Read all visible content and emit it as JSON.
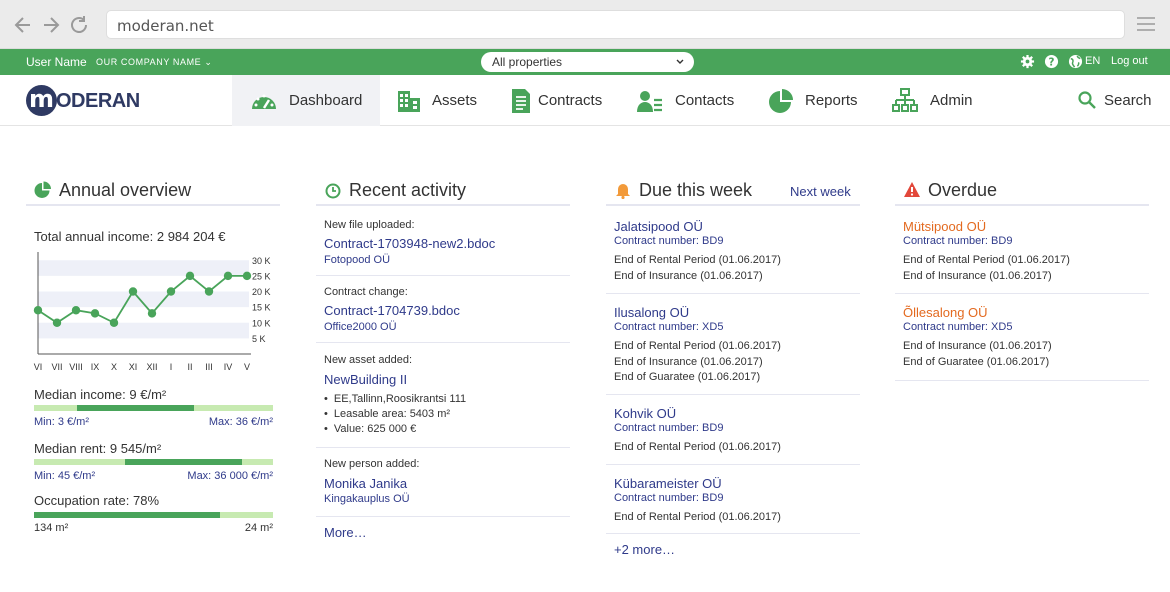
{
  "browser": {
    "url": "moderan.net"
  },
  "topbar": {
    "user_name": "User Name",
    "company": "OUR COMPANY NAME",
    "property_select": "All properties",
    "lang": "EN",
    "logout": "Log out"
  },
  "nav": {
    "logo_text": "ODERAN",
    "logo_letter": "m",
    "items": [
      {
        "label": "Dashboard",
        "icon": "gauge-icon",
        "active": true
      },
      {
        "label": "Assets",
        "icon": "building-icon"
      },
      {
        "label": "Contracts",
        "icon": "document-icon"
      },
      {
        "label": "Contacts",
        "icon": "person-list-icon"
      },
      {
        "label": "Reports",
        "icon": "pie-chart-icon"
      },
      {
        "label": "Admin",
        "icon": "org-chart-icon"
      }
    ],
    "search": "Search"
  },
  "annual": {
    "title": "Annual overview",
    "total_income": "Total annual income: 2 984 204 €",
    "median_income": "Median income: 9 €/m²",
    "median_income_min": "Min: 3 €/m²",
    "median_income_max": "Max: 36 €/m²",
    "median_rent": "Median rent: 9 545/m²",
    "median_rent_min": "Min: 45 €/m²",
    "median_rent_max": "Max: 36 000 €/m²",
    "occupation": "Occupation rate: 78%",
    "occupation_left": "134 m²",
    "occupation_right": "24 m²",
    "median_income_range": [
      0.18,
      0.67
    ],
    "median_rent_range": [
      0.38,
      0.87
    ],
    "occupation_fill": 0.78
  },
  "chart_data": {
    "type": "line",
    "categories": [
      "VI",
      "VII",
      "VIII",
      "IX",
      "X",
      "XI",
      "XII",
      "I",
      "II",
      "III",
      "IV",
      "V"
    ],
    "y_tick_labels": [
      "30 K",
      "25 K",
      "20 K",
      "15 K",
      "10 K",
      "5 K"
    ],
    "y_ticks": [
      30,
      25,
      20,
      15,
      10,
      5
    ],
    "values": [
      14,
      10,
      14,
      13,
      10,
      20,
      13,
      20,
      25,
      20,
      25,
      25
    ],
    "ylim": [
      0,
      32
    ],
    "grid": "horizontal bands",
    "color": "#49a45a"
  },
  "recent": {
    "title": "Recent activity",
    "items": [
      {
        "label": "New file uploaded:",
        "main": "Contract-1703948-new2.bdoc",
        "sub": "Fotopood OÜ"
      },
      {
        "label": "Contract change:",
        "main": "Contract-1704739.bdoc",
        "sub": "Office2000 OÜ"
      },
      {
        "label": "New asset added:",
        "main": "NewBuilding II",
        "bullets": [
          "EE,Tallinn,Roosikrantsi 111",
          "Leasable area: 5403 m²",
          "Value: 625 000 €"
        ]
      },
      {
        "label": "New person added:",
        "main": "Monika Janika",
        "sub": "Kingakauplus OÜ"
      }
    ],
    "more": "More…"
  },
  "due": {
    "title": "Due this week",
    "next": "Next week",
    "items": [
      {
        "name": "Jalatsipood OÜ",
        "contract": "Contract number: BD9",
        "events": [
          "End of Rental Period (01.06.2017)",
          "End of Insurance (01.06.2017)"
        ]
      },
      {
        "name": "Ilusalong OÜ",
        "contract": "Contract number: XD5",
        "events": [
          "End of Rental Period (01.06.2017)",
          "End of Insurance (01.06.2017)",
          "End of Guaratee (01.06.2017)"
        ]
      },
      {
        "name": "Kohvik OÜ",
        "contract": "Contract number: BD9",
        "events": [
          "End of Rental Period (01.06.2017)"
        ]
      },
      {
        "name": "Kübarameister OÜ",
        "contract": "Contract number: BD9",
        "events": [
          "End of Rental Period (01.06.2017)"
        ]
      }
    ],
    "more": "+2 more…"
  },
  "overdue": {
    "title": "Overdue",
    "items": [
      {
        "name": "Mütsipood OÜ",
        "contract": "Contract number: BD9",
        "events": [
          "End of Rental Period (01.06.2017)",
          "End of Insurance (01.06.2017)"
        ]
      },
      {
        "name": "Õllesalong OÜ",
        "contract": "Contract number: XD5",
        "events": [
          "End of Insurance (01.06.2017)",
          "End of Guaratee (01.06.2017)"
        ]
      }
    ]
  },
  "colors": {
    "brand_green": "#49a45a",
    "light_green": "#c7eab1",
    "navy": "#2f3a63",
    "link_blue": "#2f3a8a",
    "overdue_orange": "#e36a20",
    "bell_orange": "#f29a3a",
    "warn_red": "#e2473a"
  }
}
